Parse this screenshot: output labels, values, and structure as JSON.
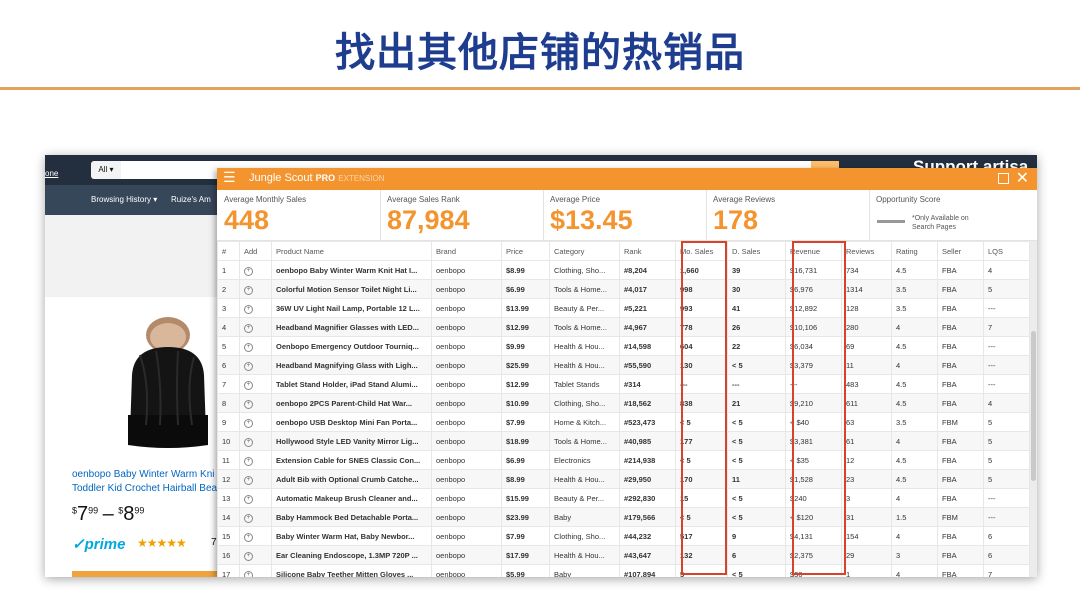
{
  "slide": {
    "title": "找出其他店铺的热销品"
  },
  "amazon": {
    "logo_fragment": "one",
    "search_scope": "All ▾",
    "support_text": "Support artisa",
    "nav": [
      "Browsing History ▾",
      "Ruize's Am"
    ],
    "product_title_line1": "oenbopo Baby Winter Warm Kni",
    "product_title_line2": "Toddler Kid Crochet Hairball Bea",
    "price_low_dollars": "7",
    "price_low_cents": "99",
    "price_sep": "–",
    "price_high_dollars": "8",
    "price_high_cents": "99",
    "currency": "$",
    "prime_label": "prime",
    "stars": "★★★★★",
    "review_count_fragment": "7"
  },
  "jungle_scout": {
    "brand": "Jungle Scout",
    "brand_pro": "PRO",
    "brand_ext": "EXTENSION",
    "stats": [
      {
        "label": "Average Monthly Sales",
        "value": "448"
      },
      {
        "label": "Average Sales Rank",
        "value": "87,984"
      },
      {
        "label": "Average Price",
        "value": "$13.45"
      },
      {
        "label": "Average Reviews",
        "value": "178"
      },
      {
        "label": "Opportunity Score",
        "value": "",
        "note": "*Only Available on Search Pages"
      }
    ],
    "columns": [
      "#",
      "Add",
      "Product Name",
      "Brand",
      "Price",
      "Category",
      "Rank",
      "Mo. Sales",
      "D. Sales",
      "Revenue",
      "Reviews",
      "Rating",
      "Seller",
      "LQS"
    ],
    "rows": [
      [
        "1",
        "",
        "oenbopo Baby Winter Warm Knit Hat I...",
        "oenbopo",
        "$8.99",
        "Clothing, Sho...",
        "#8,204",
        "1,660",
        "39",
        "$16,731",
        "734",
        "4.5",
        "FBA",
        "4"
      ],
      [
        "2",
        "",
        "Colorful Motion Sensor Toilet Night Li...",
        "oenbopo",
        "$6.99",
        "Tools & Home...",
        "#4,017",
        "998",
        "30",
        "$6,976",
        "1314",
        "3.5",
        "FBA",
        "5"
      ],
      [
        "3",
        "",
        "36W UV Light Nail Lamp, Portable 12 L...",
        "oenbopo",
        "$13.99",
        "Beauty & Per...",
        "#5,221",
        "993",
        "41",
        "$12,892",
        "128",
        "3.5",
        "FBA",
        "---"
      ],
      [
        "4",
        "",
        "Headband Magnifier Glasses with LED...",
        "oenbopo",
        "$12.99",
        "Tools & Home...",
        "#4,967",
        "778",
        "26",
        "$10,106",
        "280",
        "4",
        "FBA",
        "7"
      ],
      [
        "5",
        "",
        "Oenbopo Emergency Outdoor Tourniq...",
        "oenbopo",
        "$9.99",
        "Health & Hou...",
        "#14,598",
        "604",
        "22",
        "$6,034",
        "69",
        "4.5",
        "FBA",
        "---"
      ],
      [
        "6",
        "",
        "Headband Magnifying Glass with Ligh...",
        "oenbopo",
        "$25.99",
        "Health & Hou...",
        "#55,590",
        "130",
        "< 5",
        "$3,379",
        "11",
        "4",
        "FBA",
        "---"
      ],
      [
        "7",
        "",
        "Tablet Stand Holder, iPad Stand Alumi...",
        "oenbopo",
        "$12.99",
        "Tablet Stands",
        "#314",
        "---",
        "---",
        "---",
        "483",
        "4.5",
        "FBA",
        "---"
      ],
      [
        "8",
        "",
        "oenbopo 2PCS Parent-Child Hat War...",
        "oenbopo",
        "$10.99",
        "Clothing, Sho...",
        "#18,562",
        "838",
        "21",
        "$9,210",
        "611",
        "4.5",
        "FBA",
        "4"
      ],
      [
        "9",
        "",
        "oenbopo USB Desktop Mini Fan Porta...",
        "oenbopo",
        "$7.99",
        "Home & Kitch...",
        "#523,473",
        "< 5",
        "< 5",
        "< $40",
        "63",
        "3.5",
        "FBM",
        "5"
      ],
      [
        "10",
        "",
        "Hollywood Style LED Vanity Mirror Lig...",
        "oenbopo",
        "$18.99",
        "Tools & Home...",
        "#40,985",
        "177",
        "< 5",
        "$3,381",
        "61",
        "4",
        "FBA",
        "5"
      ],
      [
        "11",
        "",
        "Extension Cable for SNES Classic Con...",
        "oenbopo",
        "$6.99",
        "Electronics",
        "#214,938",
        "< 5",
        "< 5",
        "< $35",
        "12",
        "4.5",
        "FBA",
        "5"
      ],
      [
        "12",
        "",
        "Adult Bib with Optional Crumb Catche...",
        "oenbopo",
        "$8.99",
        "Health & Hou...",
        "#29,950",
        "170",
        "11",
        "$1,528",
        "23",
        "4.5",
        "FBA",
        "5"
      ],
      [
        "13",
        "",
        "Automatic Makeup Brush Cleaner and...",
        "oenbopo",
        "$15.99",
        "Beauty & Per...",
        "#292,830",
        "15",
        "< 5",
        "$240",
        "3",
        "4",
        "FBA",
        "---"
      ],
      [
        "14",
        "",
        "Baby Hammock Bed Detachable Porta...",
        "oenbopo",
        "$23.99",
        "Baby",
        "#179,566",
        "< 5",
        "< 5",
        "< $120",
        "31",
        "1.5",
        "FBM",
        "---"
      ],
      [
        "15",
        "",
        "Baby Winter Warm Hat, Baby Newbor...",
        "oenbopo",
        "$7.99",
        "Clothing, Sho...",
        "#44,232",
        "517",
        "9",
        "$4,131",
        "154",
        "4",
        "FBA",
        "6"
      ],
      [
        "16",
        "",
        "Ear Cleaning Endoscope, 1.3MP 720P ...",
        "oenbopo",
        "$17.99",
        "Health & Hou...",
        "#43,647",
        "132",
        "6",
        "$2,375",
        "29",
        "3",
        "FBA",
        "6"
      ],
      [
        "17",
        "",
        "Silicone Baby Teether Mitten Gloves ...",
        "oenbopo",
        "$5.99",
        "Baby",
        "#107,894",
        "5",
        "< 5",
        "$30",
        "1",
        "4",
        "FBA",
        "7"
      ]
    ]
  }
}
